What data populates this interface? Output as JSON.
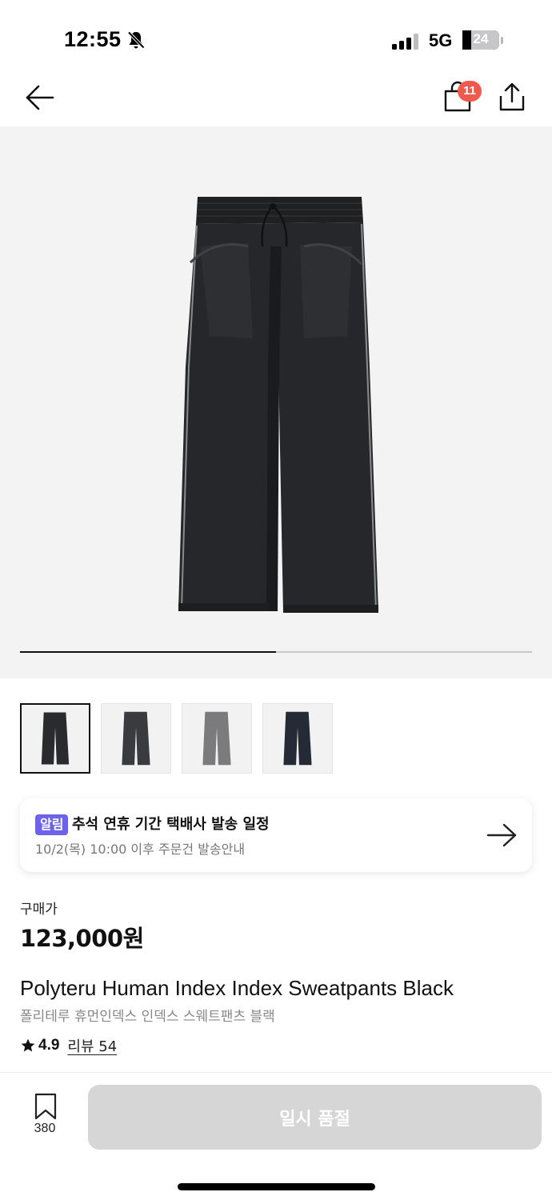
{
  "status_bar": {
    "time": "12:55",
    "network": "5G",
    "battery_percent": "24",
    "battery_level": 0.24,
    "icons": [
      "bell-slash-icon",
      "signal-icon",
      "battery-icon"
    ]
  },
  "nav": {
    "cart_badge": "11",
    "icons": [
      "arrow-left-icon",
      "shopping-bag-icon",
      "share-icon"
    ]
  },
  "gallery": {
    "progress": 0.5,
    "thumbnails": [
      {
        "color": "#2a2b2e"
      },
      {
        "color": "#3a3b3e"
      },
      {
        "color": "#7b7b7d"
      },
      {
        "color": "#242a36"
      }
    ],
    "selected_index": 0
  },
  "notice": {
    "badge": "알림",
    "title": "추석 연휴 기간 택배사 발송 일정",
    "subtitle": "10/2(목) 10:00 이후 주문건 발송안내"
  },
  "product": {
    "price_label": "구매가",
    "price": "123,000원",
    "name": "Polyteru Human Index Index Sweatpants Black",
    "name_ko": "폴리테루 휴먼인덱스 인덱스 스웨트팬츠 블랙",
    "rating": "4.9",
    "review_link": "리뷰 54"
  },
  "bottom_bar": {
    "bookmark_count": "380",
    "buy_label": "일시 품절"
  },
  "colors": {
    "badge_red": "#ef5a4f",
    "notice_purple": "#6c63e9",
    "disabled_button": "#d6d6d6"
  }
}
